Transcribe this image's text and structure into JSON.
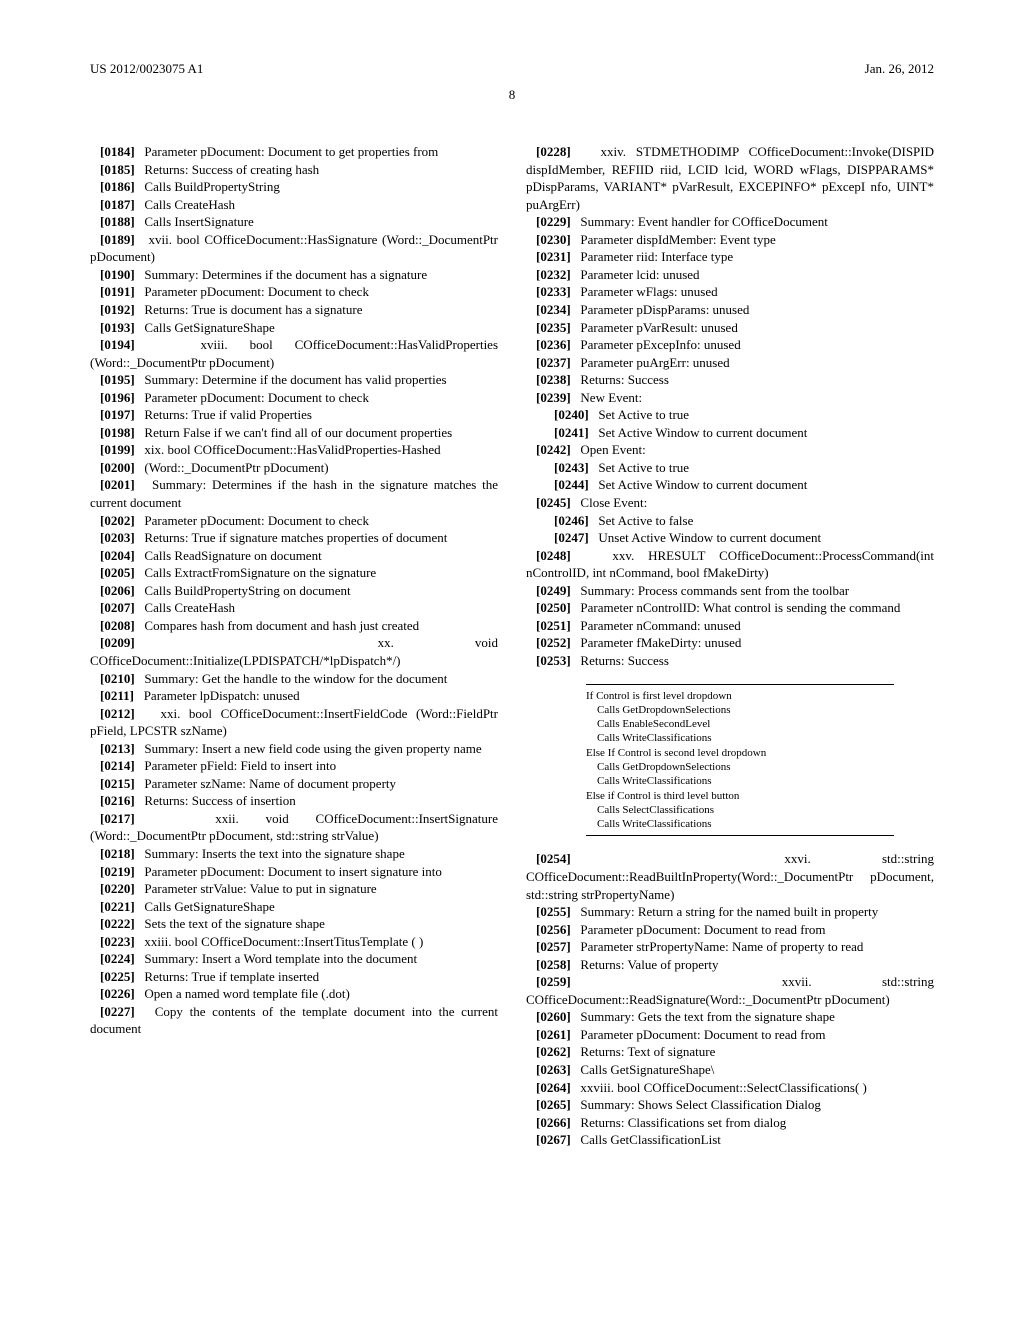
{
  "header": {
    "pub_no": "US 2012/0023075 A1",
    "pub_date": "Jan. 26, 2012"
  },
  "page_number": "8",
  "left": {
    "p0184": "Parameter pDocument: Document to get properties from",
    "p0185": "Returns: Success of creating hash",
    "p0186": "Calls BuildPropertyString",
    "p0187": "Calls CreateHash",
    "p0188": "Calls InsertSignature",
    "p0189": "xvii. bool COfficeDocument::HasSignature (Word::_DocumentPtr pDocument)",
    "p0190": "Summary: Determines if the document has a signature",
    "p0191": "Parameter pDocument: Document to check",
    "p0192": "Returns: True is document has a signature",
    "p0193": "Calls GetSignatureShape",
    "p0194": "xviii. bool COfficeDocument::HasValidProperties (Word::_DocumentPtr pDocument)",
    "p0195": "Summary: Determine if the document has valid properties",
    "p0196": "Parameter pDocument: Document to check",
    "p0197": "Returns: True if valid Properties",
    "p0198": "Return False if we can't find all of our document properties",
    "p0199": "xix. bool COfficeDocument::HasValidProperties-Hashed",
    "p0200": "(Word::_DocumentPtr pDocument)",
    "p0201": "Summary: Determines if the hash in the signature matches the current document",
    "p0202": "Parameter pDocument: Document to check",
    "p0203": "Returns: True if signature matches properties of document",
    "p0204": "Calls ReadSignature on document",
    "p0205": "Calls ExtractFromSignature on the signature",
    "p0206": "Calls BuildPropertyString on document",
    "p0207": "Calls CreateHash",
    "p0208": "Compares hash from document and hash just created",
    "p0209": "xx. void COfficeDocument::Initialize(LPDISPATCH/*lpDispatch*/)",
    "p0210": "Summary: Get the handle to the window for the document",
    "p0211": "Parameter lpDispatch: unused",
    "p0212": "xxi. bool COfficeDocument::InsertFieldCode (Word::FieldPtr pField, LPCSTR szName)",
    "p0213": "Summary: Insert a new field code using the given property name",
    "p0214": "Parameter pField: Field to insert into",
    "p0215": "Parameter szName: Name of document property",
    "p0216": "Returns: Success of insertion",
    "p0217": "xxii. void COfficeDocument::InsertSignature (Word::_DocumentPtr pDocument, std::string strValue)",
    "p0218": "Summary: Inserts the text into the signature shape",
    "p0219": "Parameter pDocument: Document to insert signature into",
    "p0220": "Parameter strValue: Value to put in signature",
    "p0221": "Calls GetSignatureShape",
    "p0222": "Sets the text of the signature shape",
    "p0223": "xxiii. bool COfficeDocument::InsertTitusTemplate ( )",
    "p0224": "Summary: Insert a Word template into the document",
    "p0225": "Returns: True if template inserted",
    "p0226": "Open a named word template file (.dot)",
    "p0227": "Copy the contents of the template document into the current document"
  },
  "right": {
    "p0228": "xxiv. STDMETHODIMP COfficeDocument::Invoke(DISPID dispIdMember, REFIID riid, LCID lcid, WORD wFlags, DISPPARAMS* pDispParams, VARIANT* pVarResult, EXCEPINFO* pExcepI nfo, UINT* puArgErr)",
    "p0229": "Summary: Event handler for COfficeDocument",
    "p0230": "Parameter dispIdMember: Event type",
    "p0231": "Parameter riid: Interface type",
    "p0232": "Parameter lcid: unused",
    "p0233": "Parameter wFlags: unused",
    "p0234": "Parameter pDispParams: unused",
    "p0235": "Parameter pVarResult: unused",
    "p0236": "Parameter pExcepInfo: unused",
    "p0237": "Parameter puArgErr: unused",
    "p0238": "Returns: Success",
    "p0239": "New Event:",
    "p0240": "Set Active to true",
    "p0241": "Set Active Window to current document",
    "p0242": "Open Event:",
    "p0243": "Set Active to true",
    "p0244": "Set Active Window to current document",
    "p0245": "Close Event:",
    "p0246": "Set Active to false",
    "p0247": "Unset Active Window to current document",
    "p0248": "xxv. HRESULT COfficeDocument::ProcessCommand(int nControlID, int nCommand, bool fMakeDirty)",
    "p0249": "Summary: Process commands sent from the toolbar",
    "p0250": "Parameter nControlID: What control is sending the command",
    "p0251": "Parameter nCommand: unused",
    "p0252": "Parameter fMakeDirty: unused",
    "p0253": "Returns: Success",
    "p0254": "xxvi. std::string COfficeDocument::ReadBuiltInProperty(Word::_DocumentPtr pDocument, std::string strPropertyName)",
    "p0255": "Summary: Return a string for the named built in property",
    "p0256": "Parameter pDocument: Document to read from",
    "p0257": "Parameter strPropertyName: Name of property to read",
    "p0258": "Returns: Value of property",
    "p0259": "xxvii. std::string COfficeDocument::ReadSignature(Word::_DocumentPtr pDocument)",
    "p0260": "Summary: Gets the text from the signature shape",
    "p0261": "Parameter pDocument: Document to read from",
    "p0262": "Returns: Text of signature",
    "p0263": "Calls GetSignatureShape\\",
    "p0264": "xxviii. bool COfficeDocument::SelectClassifications( )",
    "p0265": "Summary: Shows Select Classification Dialog",
    "p0266": "Returns: Classifications set from dialog",
    "p0267": "Calls GetClassificationList"
  },
  "code": {
    "l1": "If Control is first level dropdown",
    "l2": "    Calls GetDropdownSelections",
    "l3": "    Calls EnableSecondLevel",
    "l4": "    Calls WriteClassifications",
    "l5": "Else If Control is second level dropdown",
    "l6": "    Calls GetDropdownSelections",
    "l7": "    Calls WriteClassifications",
    "l8": "Else if Control is third level button",
    "l9": "    Calls SelectClassifications",
    "l10": "    Calls WriteClassifications"
  }
}
